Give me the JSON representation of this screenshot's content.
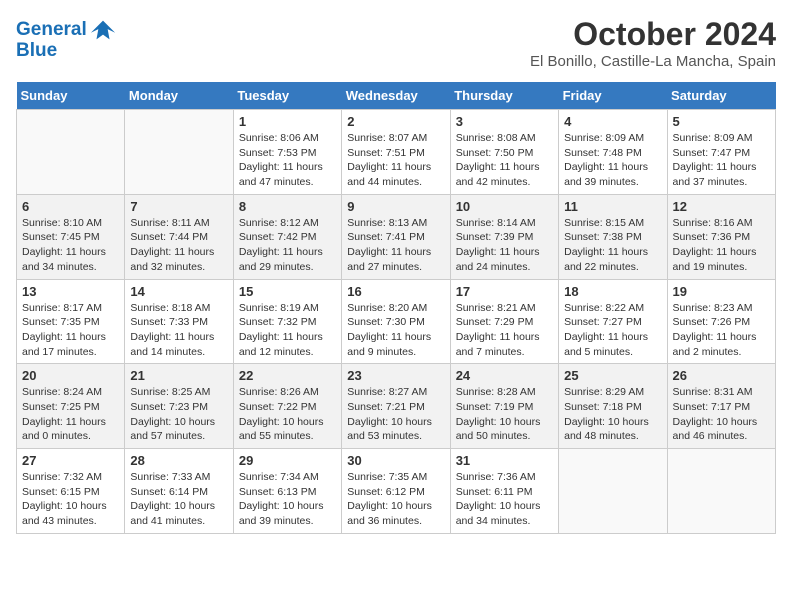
{
  "header": {
    "logo_line1": "General",
    "logo_line2": "Blue",
    "month": "October 2024",
    "location": "El Bonillo, Castille-La Mancha, Spain"
  },
  "days_of_week": [
    "Sunday",
    "Monday",
    "Tuesday",
    "Wednesday",
    "Thursday",
    "Friday",
    "Saturday"
  ],
  "weeks": [
    [
      {
        "day": "",
        "info": ""
      },
      {
        "day": "",
        "info": ""
      },
      {
        "day": "1",
        "info": "Sunrise: 8:06 AM\nSunset: 7:53 PM\nDaylight: 11 hours and 47 minutes."
      },
      {
        "day": "2",
        "info": "Sunrise: 8:07 AM\nSunset: 7:51 PM\nDaylight: 11 hours and 44 minutes."
      },
      {
        "day": "3",
        "info": "Sunrise: 8:08 AM\nSunset: 7:50 PM\nDaylight: 11 hours and 42 minutes."
      },
      {
        "day": "4",
        "info": "Sunrise: 8:09 AM\nSunset: 7:48 PM\nDaylight: 11 hours and 39 minutes."
      },
      {
        "day": "5",
        "info": "Sunrise: 8:09 AM\nSunset: 7:47 PM\nDaylight: 11 hours and 37 minutes."
      }
    ],
    [
      {
        "day": "6",
        "info": "Sunrise: 8:10 AM\nSunset: 7:45 PM\nDaylight: 11 hours and 34 minutes."
      },
      {
        "day": "7",
        "info": "Sunrise: 8:11 AM\nSunset: 7:44 PM\nDaylight: 11 hours and 32 minutes."
      },
      {
        "day": "8",
        "info": "Sunrise: 8:12 AM\nSunset: 7:42 PM\nDaylight: 11 hours and 29 minutes."
      },
      {
        "day": "9",
        "info": "Sunrise: 8:13 AM\nSunset: 7:41 PM\nDaylight: 11 hours and 27 minutes."
      },
      {
        "day": "10",
        "info": "Sunrise: 8:14 AM\nSunset: 7:39 PM\nDaylight: 11 hours and 24 minutes."
      },
      {
        "day": "11",
        "info": "Sunrise: 8:15 AM\nSunset: 7:38 PM\nDaylight: 11 hours and 22 minutes."
      },
      {
        "day": "12",
        "info": "Sunrise: 8:16 AM\nSunset: 7:36 PM\nDaylight: 11 hours and 19 minutes."
      }
    ],
    [
      {
        "day": "13",
        "info": "Sunrise: 8:17 AM\nSunset: 7:35 PM\nDaylight: 11 hours and 17 minutes."
      },
      {
        "day": "14",
        "info": "Sunrise: 8:18 AM\nSunset: 7:33 PM\nDaylight: 11 hours and 14 minutes."
      },
      {
        "day": "15",
        "info": "Sunrise: 8:19 AM\nSunset: 7:32 PM\nDaylight: 11 hours and 12 minutes."
      },
      {
        "day": "16",
        "info": "Sunrise: 8:20 AM\nSunset: 7:30 PM\nDaylight: 11 hours and 9 minutes."
      },
      {
        "day": "17",
        "info": "Sunrise: 8:21 AM\nSunset: 7:29 PM\nDaylight: 11 hours and 7 minutes."
      },
      {
        "day": "18",
        "info": "Sunrise: 8:22 AM\nSunset: 7:27 PM\nDaylight: 11 hours and 5 minutes."
      },
      {
        "day": "19",
        "info": "Sunrise: 8:23 AM\nSunset: 7:26 PM\nDaylight: 11 hours and 2 minutes."
      }
    ],
    [
      {
        "day": "20",
        "info": "Sunrise: 8:24 AM\nSunset: 7:25 PM\nDaylight: 11 hours and 0 minutes."
      },
      {
        "day": "21",
        "info": "Sunrise: 8:25 AM\nSunset: 7:23 PM\nDaylight: 10 hours and 57 minutes."
      },
      {
        "day": "22",
        "info": "Sunrise: 8:26 AM\nSunset: 7:22 PM\nDaylight: 10 hours and 55 minutes."
      },
      {
        "day": "23",
        "info": "Sunrise: 8:27 AM\nSunset: 7:21 PM\nDaylight: 10 hours and 53 minutes."
      },
      {
        "day": "24",
        "info": "Sunrise: 8:28 AM\nSunset: 7:19 PM\nDaylight: 10 hours and 50 minutes."
      },
      {
        "day": "25",
        "info": "Sunrise: 8:29 AM\nSunset: 7:18 PM\nDaylight: 10 hours and 48 minutes."
      },
      {
        "day": "26",
        "info": "Sunrise: 8:31 AM\nSunset: 7:17 PM\nDaylight: 10 hours and 46 minutes."
      }
    ],
    [
      {
        "day": "27",
        "info": "Sunrise: 7:32 AM\nSunset: 6:15 PM\nDaylight: 10 hours and 43 minutes."
      },
      {
        "day": "28",
        "info": "Sunrise: 7:33 AM\nSunset: 6:14 PM\nDaylight: 10 hours and 41 minutes."
      },
      {
        "day": "29",
        "info": "Sunrise: 7:34 AM\nSunset: 6:13 PM\nDaylight: 10 hours and 39 minutes."
      },
      {
        "day": "30",
        "info": "Sunrise: 7:35 AM\nSunset: 6:12 PM\nDaylight: 10 hours and 36 minutes."
      },
      {
        "day": "31",
        "info": "Sunrise: 7:36 AM\nSunset: 6:11 PM\nDaylight: 10 hours and 34 minutes."
      },
      {
        "day": "",
        "info": ""
      },
      {
        "day": "",
        "info": ""
      }
    ]
  ]
}
